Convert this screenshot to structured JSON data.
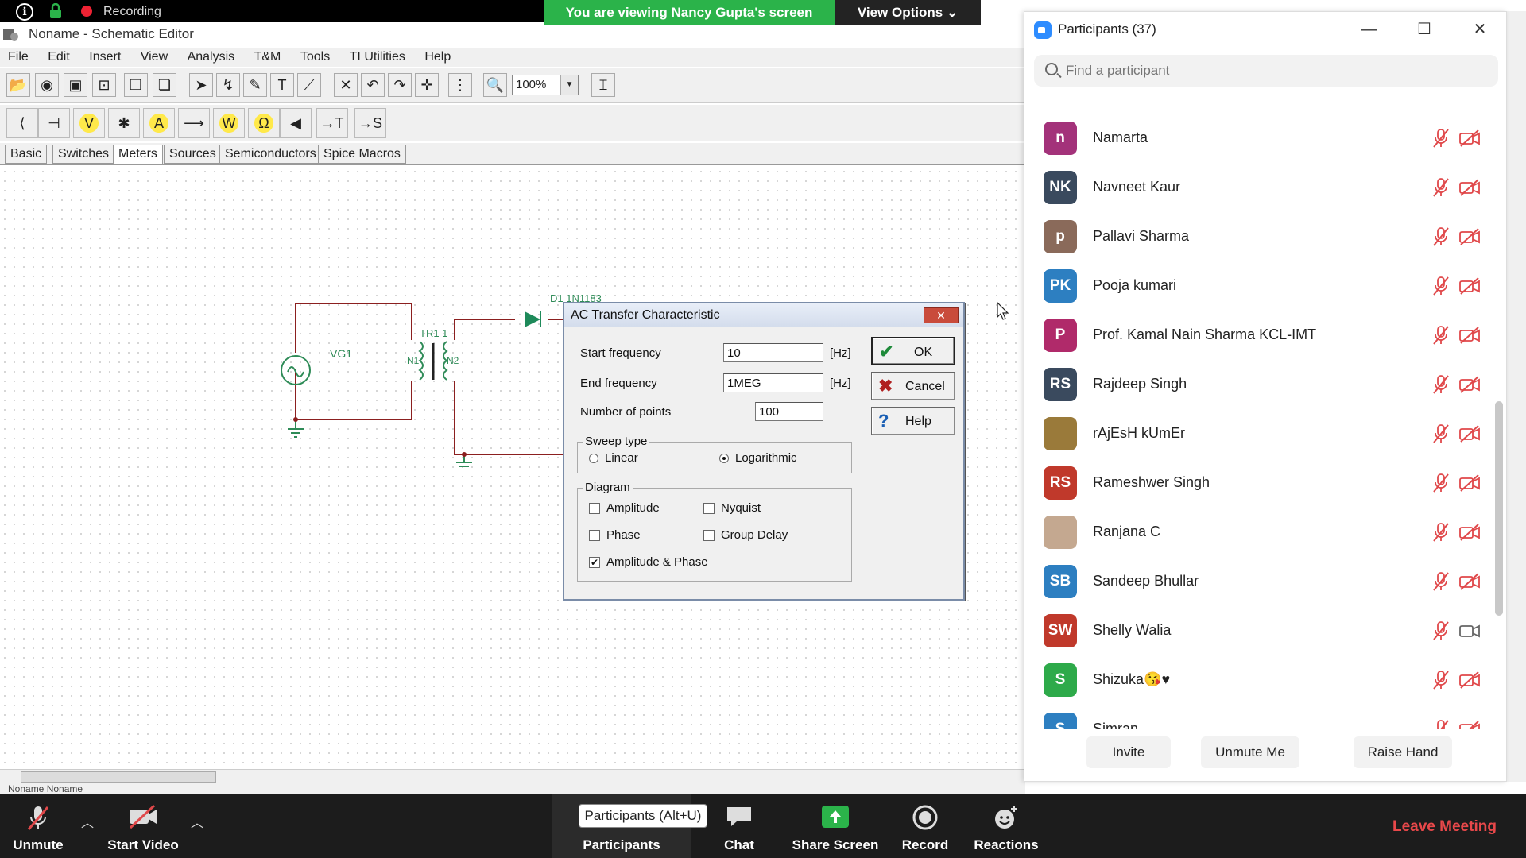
{
  "recording_bar": {
    "status_text": "Recording"
  },
  "screen_share": {
    "banner": "You are viewing Nancy Gupta's screen",
    "view_options": "View Options"
  },
  "editor": {
    "window_title": "Noname - Schematic Editor",
    "menu": [
      "File",
      "Edit",
      "Insert",
      "View",
      "Analysis",
      "T&M",
      "Tools",
      "TI Utilities",
      "Help"
    ],
    "zoom_level": "100%",
    "component_tabs": [
      "Basic",
      "Switches",
      "Meters",
      "Sources",
      "Semiconductors",
      "Spice Macros"
    ],
    "active_tab": "Meters",
    "status_strip": "Noname    Noname",
    "circuit_labels": {
      "source": "VG1",
      "transformer": "TR1 1",
      "winding1": "N1",
      "winding2": "N2",
      "diode": "D1 1N1183"
    }
  },
  "dialog": {
    "title": "AC Transfer Characteristic",
    "close": "✕",
    "start_frequency": {
      "label": "Start frequency",
      "value": "10",
      "unit": "[Hz]"
    },
    "end_frequency": {
      "label": "End frequency",
      "value": "1MEG",
      "unit": "[Hz]"
    },
    "number_of_points": {
      "label": "Number of points",
      "value": "100"
    },
    "sweep_type": {
      "label": "Sweep type",
      "options": [
        "Linear",
        "Logarithmic"
      ],
      "selected": "Logarithmic"
    },
    "diagram": {
      "label": "Diagram",
      "amplitude": "Amplitude",
      "nyquist": "Nyquist",
      "phase": "Phase",
      "group_delay": "Group Delay",
      "amplitude_phase": "Amplitude & Phase",
      "checked": "Amplitude & Phase"
    },
    "buttons": {
      "ok": "OK",
      "cancel": "Cancel",
      "help": "Help"
    }
  },
  "participants_panel": {
    "title": "Participants (37)",
    "search_placeholder": "Find a participant",
    "participants": [
      {
        "initials": "n",
        "name": "Namarta",
        "color": "#a3327a",
        "video": "off"
      },
      {
        "initials": "NK",
        "name": "Navneet Kaur",
        "color": "#3a4a5e",
        "video": "off"
      },
      {
        "initials": "p",
        "name": "Pallavi Sharma",
        "color": "#8a6a5a",
        "video": "off"
      },
      {
        "initials": "PK",
        "name": "Pooja kumari",
        "color": "#2d7fc1",
        "video": "off"
      },
      {
        "initials": "P",
        "name": "Prof. Kamal Nain Sharma KCL-IMT",
        "color": "#b02a6a",
        "video": "off"
      },
      {
        "initials": "RS",
        "name": "Rajdeep Singh",
        "color": "#3a4a5e",
        "video": "off"
      },
      {
        "initials": "",
        "name": "rAjEsH kUmEr",
        "color": "#9a7a3a",
        "video": "off"
      },
      {
        "initials": "RS",
        "name": "Rameshwer Singh",
        "color": "#c0392b",
        "video": "off"
      },
      {
        "initials": "",
        "name": "Ranjana C",
        "color": "#c4a890",
        "video": "off"
      },
      {
        "initials": "SB",
        "name": "Sandeep Bhullar",
        "color": "#2d7fc1",
        "video": "off"
      },
      {
        "initials": "SW",
        "name": "Shelly Walia",
        "color": "#c0392b",
        "video": "on"
      },
      {
        "initials": "S",
        "name": "Shizuka😘♥",
        "color": "#2eaa4a",
        "video": "off"
      },
      {
        "initials": "S",
        "name": "Simran",
        "color": "#2d7fc1",
        "video": "off"
      }
    ],
    "footer": {
      "invite": "Invite",
      "unmute_me": "Unmute Me",
      "raise_hand": "Raise Hand"
    }
  },
  "meeting_controls": {
    "unmute": "Unmute",
    "start_video": "Start Video",
    "participants": "Participants",
    "participants_tooltip": "Participants (Alt+U)",
    "chat": "Chat",
    "share_screen": "Share Screen",
    "record": "Record",
    "reactions": "Reactions",
    "leave": "Leave Meeting"
  },
  "colors": {
    "share_banner": "#2bb34a",
    "leave": "#e8484a",
    "muted_icon": "#e0484a"
  }
}
